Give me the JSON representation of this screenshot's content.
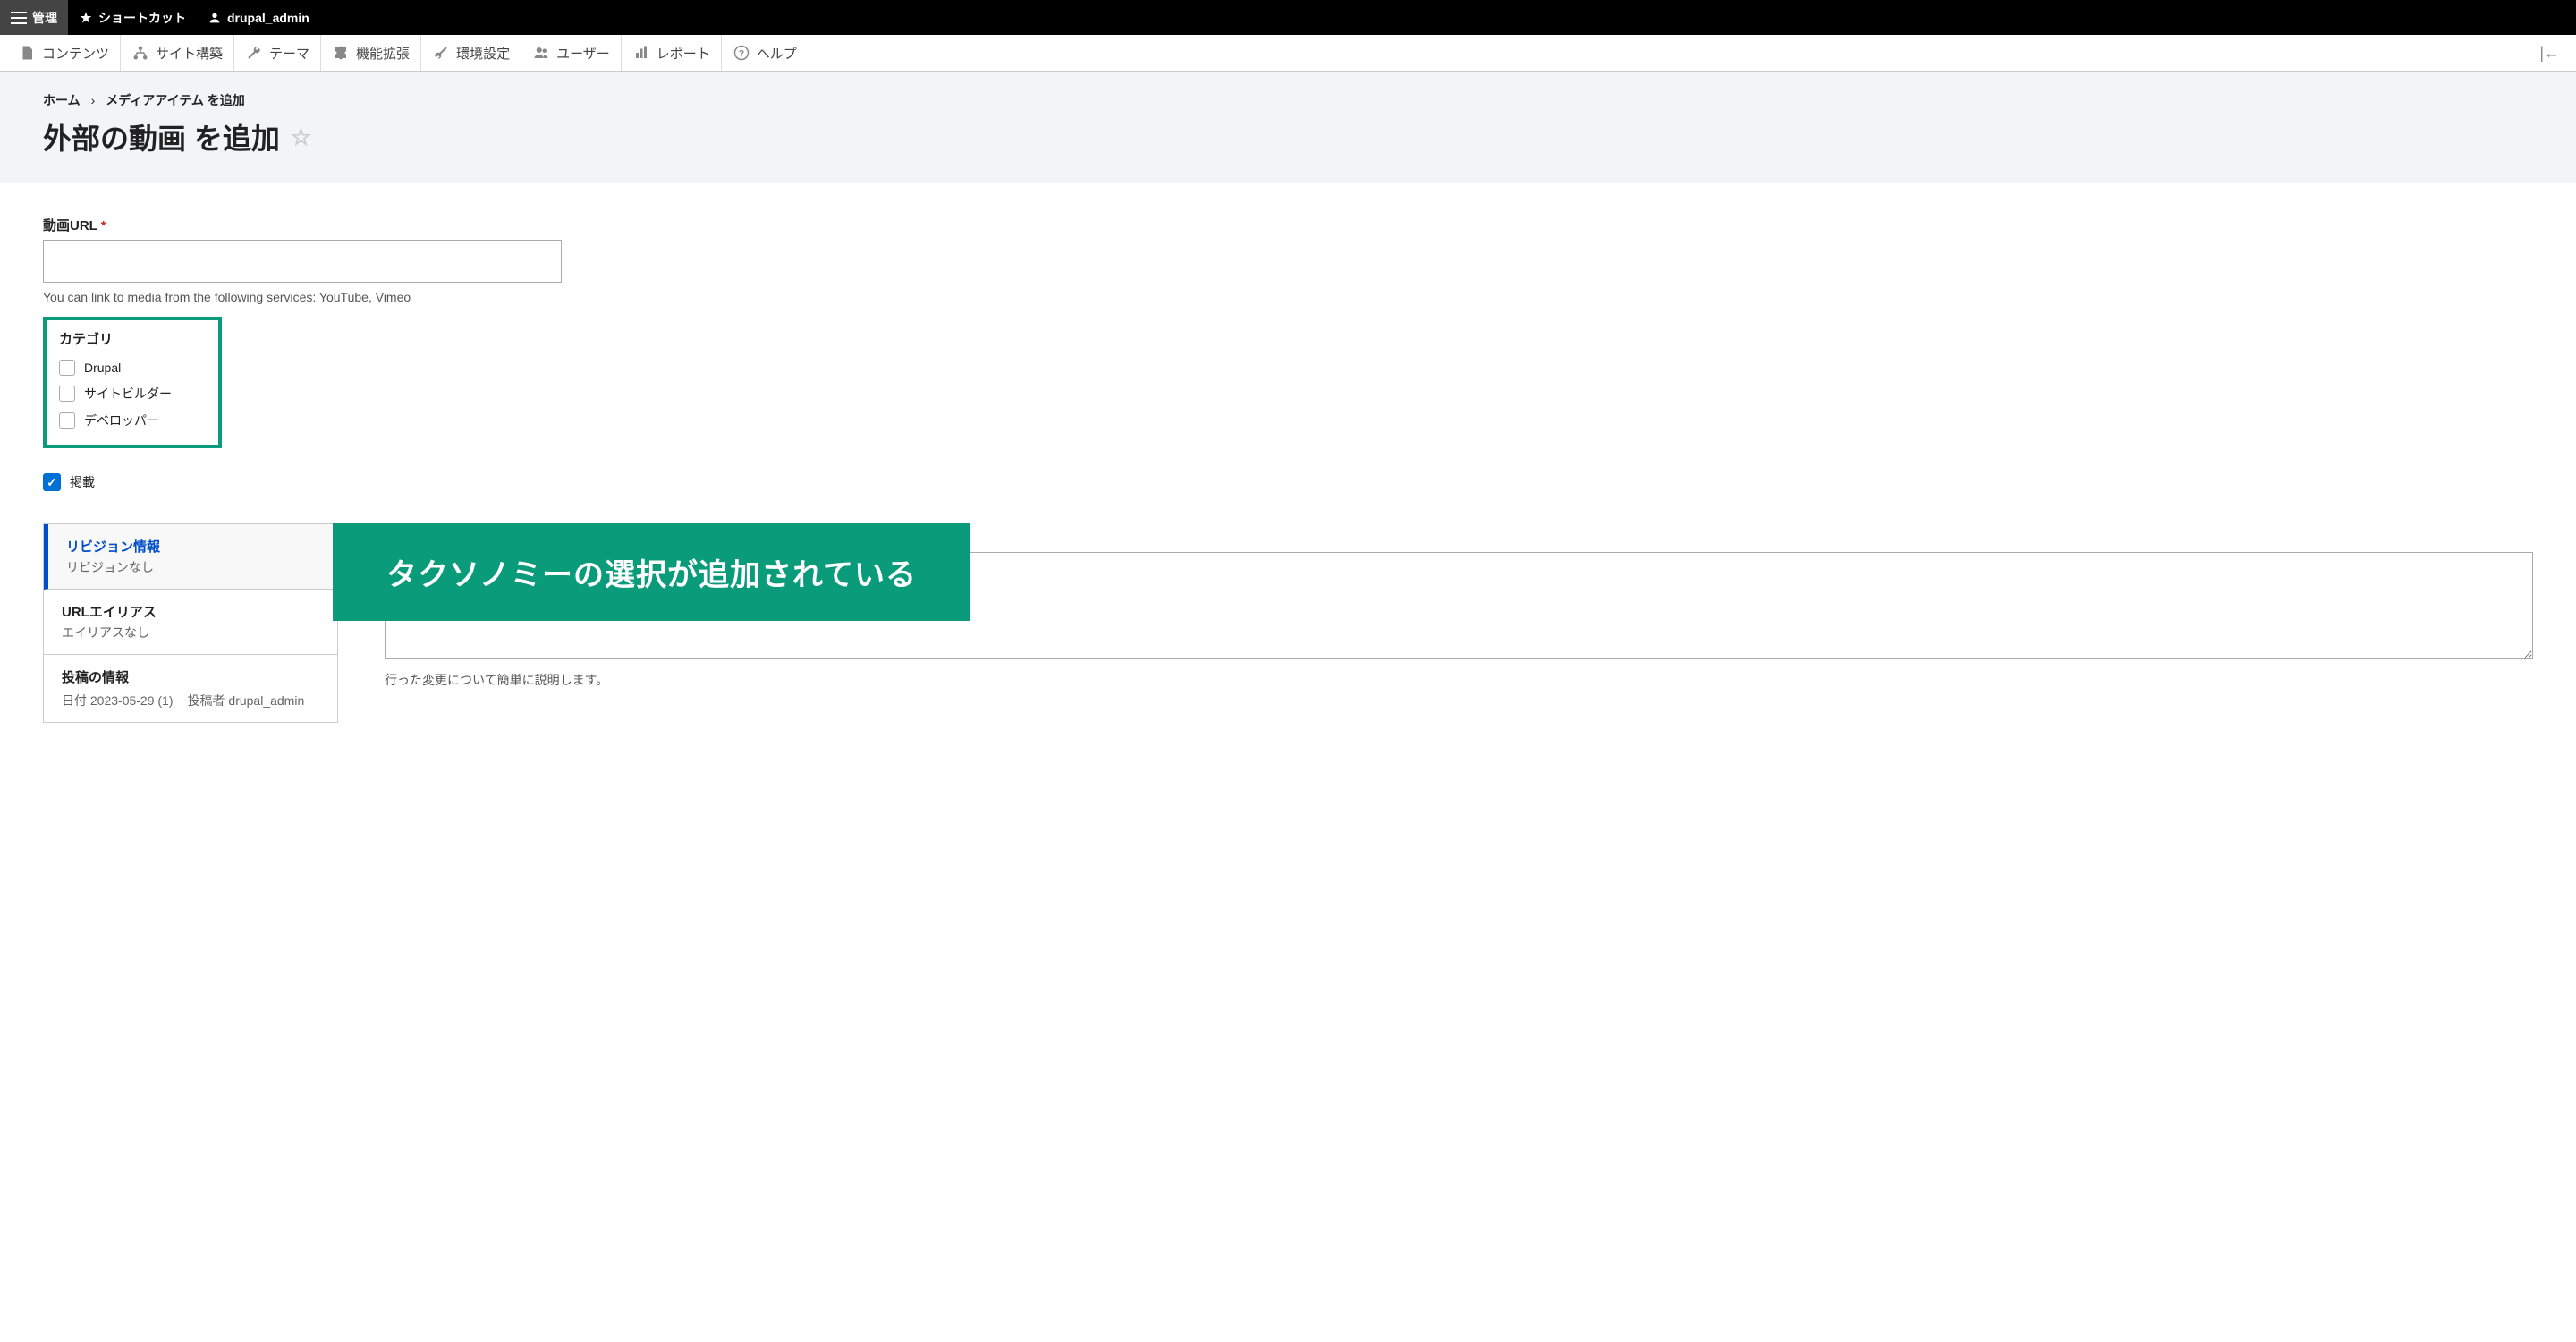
{
  "topbar": {
    "manage": "管理",
    "shortcuts": "ショートカット",
    "user": "drupal_admin"
  },
  "adminmenu": {
    "content": "コンテンツ",
    "structure": "サイト構築",
    "appearance": "テーマ",
    "extend": "機能拡張",
    "config": "環境設定",
    "people": "ユーザー",
    "reports": "レポート",
    "help": "ヘルプ"
  },
  "breadcrumb": {
    "home": "ホーム",
    "sep": "›",
    "add_media": "メディアアイテム を追加"
  },
  "page_title": "外部の動画 を追加",
  "form": {
    "video_url_label": "動画URL",
    "video_url_help": "You can link to media from the following services: YouTube, Vimeo",
    "category_label": "カテゴリ",
    "categories": [
      "Drupal",
      "サイトビルダー",
      "デベロッパー"
    ],
    "published_label": "掲載"
  },
  "tabs": {
    "revision": {
      "title": "リビジョン情報",
      "sub": "リビジョンなし"
    },
    "alias": {
      "title": "URLエイリアス",
      "sub": "エイリアスなし"
    },
    "author": {
      "title": "投稿の情報",
      "date_label": "日付 2023-05-29 (1)",
      "by_label": "投稿者 drupal_admin"
    }
  },
  "revision_help": "行った変更について簡単に説明します。",
  "annotation": "タクソノミーの選択が追加されている"
}
